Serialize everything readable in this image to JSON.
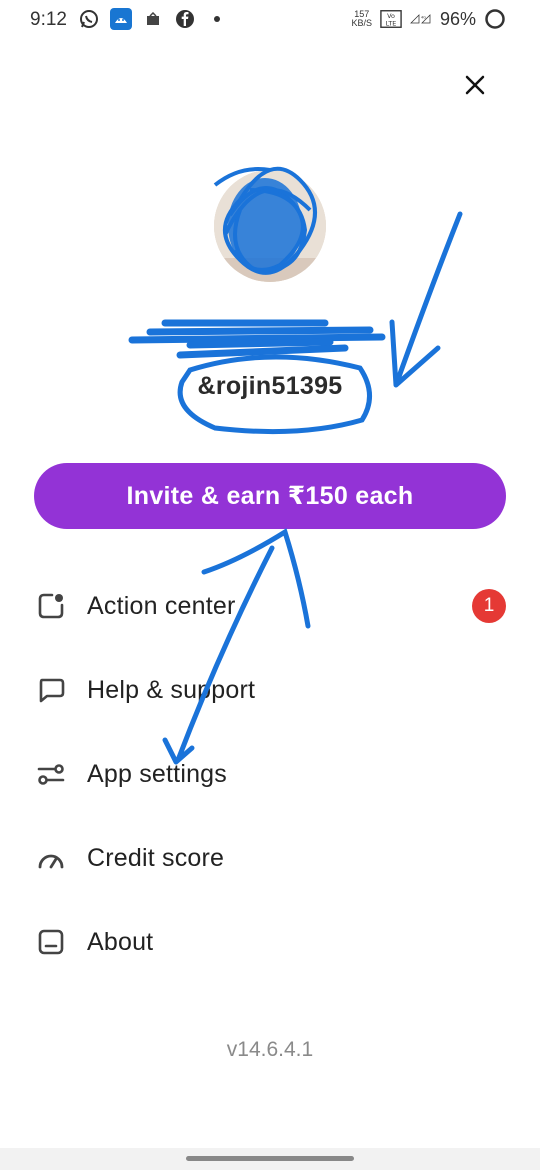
{
  "status_bar": {
    "time": "9:12",
    "speed_value": "157",
    "speed_unit": "KB/S",
    "battery_percent": "96%",
    "icons": [
      "whatsapp-icon",
      "android-icon",
      "notification-icon",
      "facebook-icon",
      "dot-icon",
      "volte-icon",
      "signal-icon"
    ]
  },
  "profile": {
    "username": "&rojin51395"
  },
  "invite": {
    "label": "Invite & earn ₹150 each"
  },
  "menu": {
    "items": [
      {
        "label": "Action center",
        "icon": "action-center-icon",
        "badge": "1"
      },
      {
        "label": "Help & support",
        "icon": "chat-icon"
      },
      {
        "label": "App settings",
        "icon": "settings-sliders-icon"
      },
      {
        "label": "Credit score",
        "icon": "gauge-icon"
      },
      {
        "label": "About",
        "icon": "about-icon"
      }
    ]
  },
  "version": "v14.6.4.1",
  "colors": {
    "accent": "#9333d6",
    "badge": "#e53935",
    "annotation": "#1a73d9"
  }
}
